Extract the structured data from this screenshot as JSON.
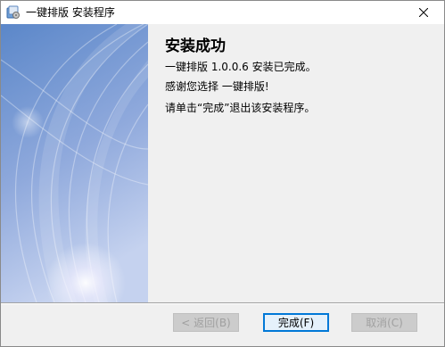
{
  "window": {
    "title": "一键排版 安装程序",
    "close_label": "✕"
  },
  "content": {
    "heading": "安装成功",
    "line1": "一键排版 1.0.0.6 安装已完成。",
    "line2": "感谢您选择 一键排版!",
    "line3": "请单击“完成”退出该安装程序。"
  },
  "buttons": {
    "back": "< 返回(B)",
    "finish": "完成(F)",
    "cancel": "取消(C)"
  },
  "colors": {
    "accent": "#0078d7",
    "side_art_top": "#5a86c8",
    "side_art_bottom": "#b9c9ea"
  },
  "icons": {
    "app": "installer-icon",
    "close": "close-icon"
  }
}
